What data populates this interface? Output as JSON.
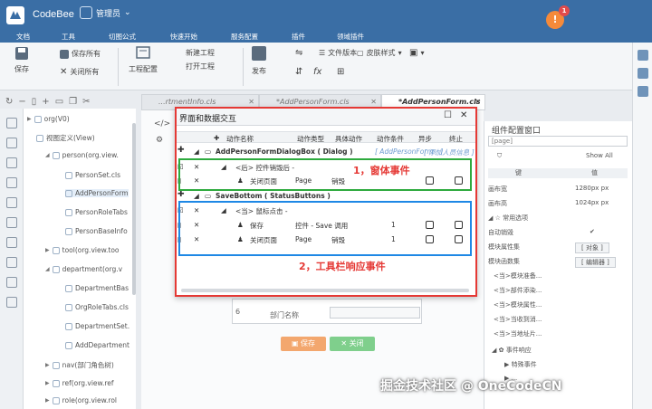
{
  "app": {
    "name": "CodeBee",
    "user": "管理员",
    "notifications": "1",
    "notif_glyph": "!"
  },
  "menu": [
    "文档",
    "工具",
    "切图公式",
    "快速开始",
    "服务配置",
    "插件",
    "领域插件"
  ],
  "ribbon": {
    "save": "保存",
    "save_all": "保存所有",
    "close_all": "关闭所有",
    "project_config": "工程配置",
    "new_project": "新建工程",
    "open_project": "打开工程",
    "publish": "发布",
    "file_version": "文件版本",
    "skin_style": "皮肤样式"
  },
  "tree": {
    "items": [
      {
        "label": "org(V0)"
      },
      {
        "label": "视图定义(View)"
      },
      {
        "label": "person(org.view."
      },
      {
        "label": "PersonSet.cls"
      },
      {
        "label": "AddPersonForm"
      },
      {
        "label": "PersonRoleTabs"
      },
      {
        "label": "PersonBaseInfo"
      },
      {
        "label": "tool(org.view.too"
      },
      {
        "label": "department(org.v"
      },
      {
        "label": "DepartmentBas"
      },
      {
        "label": "OrgRoleTabs.cls"
      },
      {
        "label": "DepartmentSet."
      },
      {
        "label": "AddDepartment"
      },
      {
        "label": "nav(部门角色树)"
      },
      {
        "label": "ref(org.view.ref"
      },
      {
        "label": "role(org.view.rol"
      }
    ]
  },
  "tabs": [
    {
      "label": "...rtmentInfo.cls"
    },
    {
      "label": "*AddPersonForm.cls"
    },
    {
      "label": "*AddPersonForm.cls"
    }
  ],
  "canvas": {
    "row_no": "6",
    "field_label": "部门名称",
    "save_btn": "保存",
    "close_btn": "关闭"
  },
  "property_panel": {
    "title": "组件配置窗口",
    "search": "[page]",
    "show_all": "Show All",
    "col_key": "键",
    "col_value": "值",
    "rows": [
      {
        "k": "画布宽",
        "v": "1280px px"
      },
      {
        "k": "画布高",
        "v": "1024px px"
      },
      {
        "k": "常用选项",
        "v": ""
      },
      {
        "k": "自动销毁",
        "v": "✔"
      },
      {
        "k": "模块属性集",
        "v": "[ 对象 ]"
      },
      {
        "k": "模块函数集",
        "v": "[ 编辑器 ]"
      },
      {
        "k": "<当>模块准备...",
        "v": ""
      },
      {
        "k": "<当>部件添染...",
        "v": ""
      },
      {
        "k": "<当>模块属性...",
        "v": ""
      },
      {
        "k": "<当>当收到消...",
        "v": ""
      },
      {
        "k": "<当>当地址片...",
        "v": ""
      },
      {
        "k": "事件响应",
        "v": ""
      },
      {
        "k": "特殊事件",
        "v": ""
      },
      {
        "k": "...",
        "v": ""
      }
    ]
  },
  "dialog": {
    "title": "界面和数据交互",
    "max_glyph": "☐",
    "close_glyph": "✕",
    "columns": [
      "动作名称",
      "动作类型",
      "具体动作",
      "动作条件",
      "异步",
      "终止"
    ],
    "group1": {
      "name": "AddPersonFormDialogBox ( Dialog )",
      "extra": "[ AddPersonForm - ]",
      "add": "[ 添加人员信息 ]"
    },
    "event1": "<后> 控件销毁后 -",
    "row1": {
      "name": "关闭页面",
      "type": "Page",
      "action": "销毁"
    },
    "group2": {
      "name": "SaveBottom ( StatusButtons )"
    },
    "event2": "<当> 鼠标点击 -",
    "row2": {
      "name": "保存",
      "type": "控件 - Save 调用",
      "cond": "1"
    },
    "row3": {
      "name": "关闭页面",
      "type": "Page",
      "action": "销毁",
      "cond": "1"
    }
  },
  "annotations": {
    "window_events": "1，窗体事件",
    "toolbar_events": "2，工具栏响应事件"
  },
  "watermark": "掘金技术社区 @ OneCodeCN"
}
